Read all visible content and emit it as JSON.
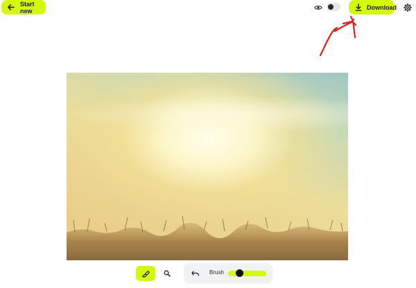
{
  "header": {
    "start_new_label": "Start new",
    "download_label": "Download",
    "icons": {
      "start_new": "arrow-left-icon",
      "preview": "eye-icon",
      "compare_toggle": "toggle-icon",
      "download": "download-icon",
      "settings": "gear-icon"
    },
    "compare_toggle_on": false
  },
  "annotation": {
    "type": "hand-drawn-arrow",
    "color": "#e01e1e",
    "points_to": "download-button"
  },
  "canvas": {
    "image": "wheat field at sunset"
  },
  "toolbar": {
    "eraser_icon": "eraser-icon",
    "zoom_icon": "zoom-icon",
    "undo_icon": "undo-icon",
    "brush_label": "Brush",
    "brush_size_fraction": 0.25
  },
  "colors": {
    "accent": "#d4f80e",
    "panel": "#f1f2f4",
    "annotation": "#e01e1e"
  }
}
